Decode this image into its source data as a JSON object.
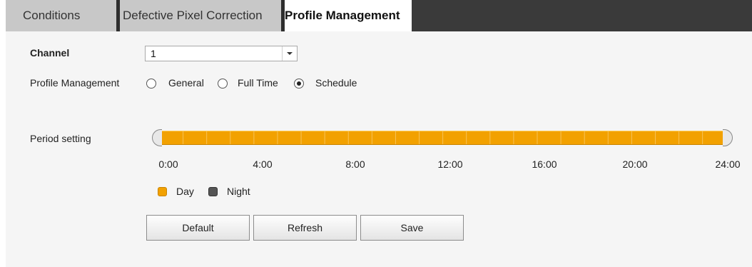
{
  "tabs": [
    {
      "label": "Conditions",
      "active": false
    },
    {
      "label": "Defective Pixel Correction",
      "active": false
    },
    {
      "label": "Profile Management",
      "active": true
    }
  ],
  "form": {
    "channel_label": "Channel",
    "channel_value": "1",
    "profile_label": "Profile Management",
    "profile_options": [
      {
        "label": "General",
        "checked": false
      },
      {
        "label": "Full Time",
        "checked": false
      },
      {
        "label": "Schedule",
        "checked": true
      }
    ],
    "period_label": "Period setting"
  },
  "schedule": {
    "ticks": [
      "0:00",
      "4:00",
      "8:00",
      "12:00",
      "16:00",
      "20:00",
      "24:00"
    ],
    "day_color": "#f2a100",
    "night_color": "#555555",
    "day_period": {
      "start": 0,
      "end": 24
    }
  },
  "legend": {
    "day_label": "Day",
    "night_label": "Night"
  },
  "buttons": {
    "default_label": "Default",
    "refresh_label": "Refresh",
    "save_label": "Save"
  }
}
